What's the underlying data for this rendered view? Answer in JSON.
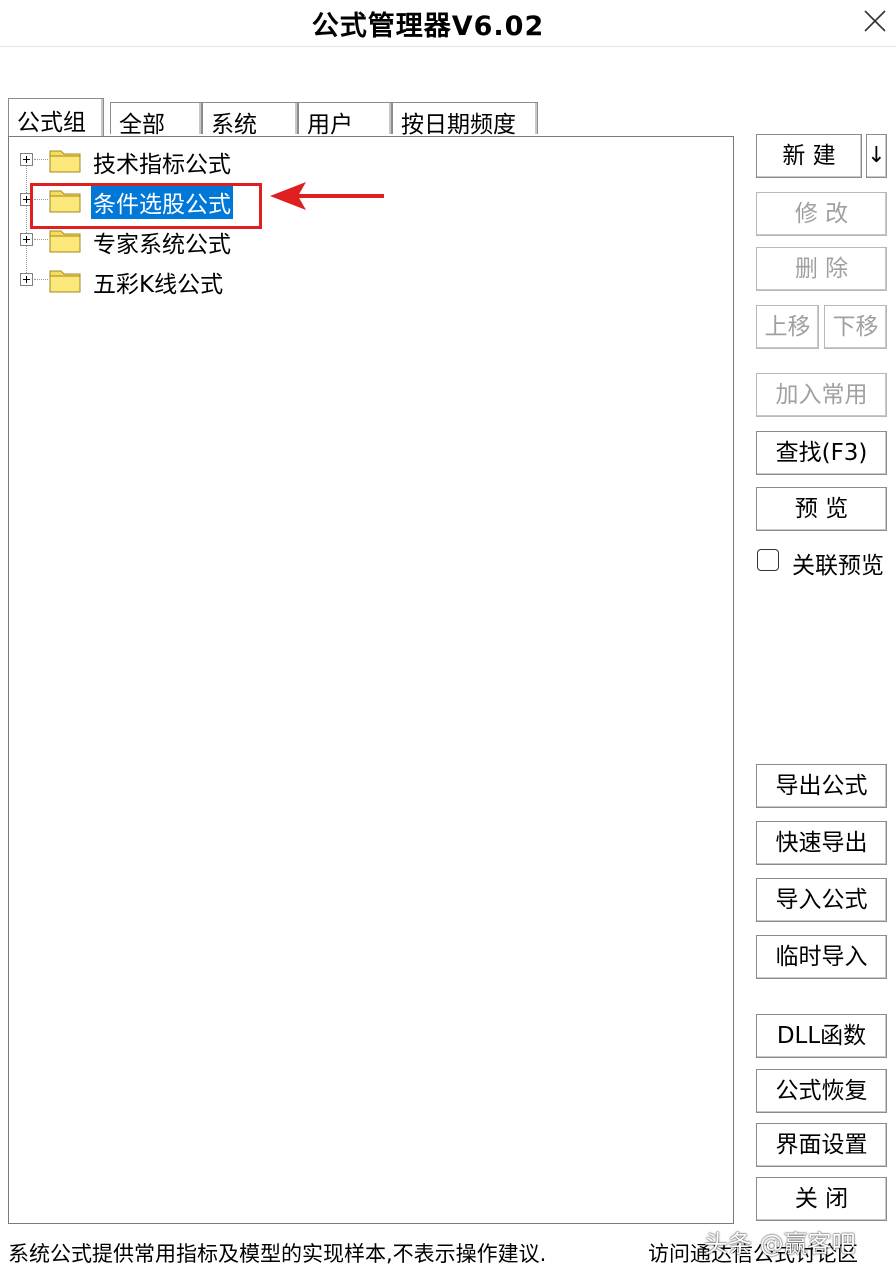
{
  "window": {
    "title": "公式管理器V6.02"
  },
  "tabs": [
    {
      "label": "公式组",
      "active": true
    },
    {
      "label": "全部",
      "active": false
    },
    {
      "label": "系统",
      "active": false
    },
    {
      "label": "用户",
      "active": false
    },
    {
      "label": "按日期频度",
      "active": false
    }
  ],
  "tree": {
    "nodes": [
      {
        "label": "技术指标公式",
        "selected": false
      },
      {
        "label": "条件选股公式",
        "selected": true
      },
      {
        "label": "专家系统公式",
        "selected": false
      },
      {
        "label": "五彩K线公式",
        "selected": false
      }
    ]
  },
  "buttons": {
    "new": "新 建",
    "new_arrow": "↓",
    "modify": "修 改",
    "delete": "删 除",
    "move_up": "上移",
    "move_down": "下移",
    "add_common": "加入常用",
    "find": "查找(F3)",
    "preview": "预 览",
    "export": "导出公式",
    "quick_export": "快速导出",
    "import": "导入公式",
    "temp_import": "临时导入",
    "dll": "DLL函数",
    "restore": "公式恢复",
    "ui_settings": "界面设置",
    "close": "关 闭"
  },
  "linked_preview": {
    "label": "关联预览",
    "checked": false
  },
  "status": {
    "left": "系统公式提供常用指标及模型的实现样本,不表示操作建议.",
    "right": "访问通达信公式讨论区"
  },
  "watermark": "头条 @赢客吧",
  "colors": {
    "selection": "#0078d7",
    "annotation": "#e02020",
    "folder": "#f6dc5a",
    "disabled_text": "#a0a0a0"
  }
}
